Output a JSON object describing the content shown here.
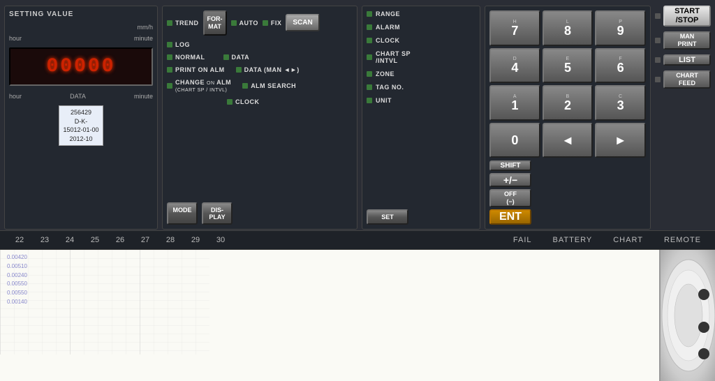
{
  "panel": {
    "setting_value": {
      "title": "SETTING VALUE",
      "unit_label": "mm/h",
      "hour_label": "hour",
      "minute_label": "minute",
      "display_value": "00000",
      "data_label": "DATA",
      "bottom_hour": "hour",
      "bottom_minute": "minute"
    },
    "sticker": {
      "line1": "256429",
      "line2": "D-K-",
      "line3": "15012-01-00",
      "line4": "2012-10"
    },
    "buttons": {
      "trend": "TREND",
      "log": "LOG",
      "format": "FOR-\nMAT",
      "auto": "AUTO",
      "fix": "FIX",
      "scan": "SCAN",
      "normal": "NORMAL",
      "data": "DATA",
      "print_on_alm": "PRINT ON ALM",
      "data_man": "DATA (MAN ◄►)",
      "change_on_alm": "CHANGE ON ALM",
      "change_sub": "(CHART SP / INTVL)",
      "alm_search": "ALM SEARCH",
      "clock": "CLOCK",
      "mode": "MODE",
      "display": "DIS-\nPLAY",
      "set": "SET"
    },
    "indicators": {
      "range": "RANGE",
      "alarm": "ALARM",
      "clock": "CLOCK",
      "chart_sp": "CHART SP\n/INTVL",
      "zone": "ZONE",
      "tag_no": "TAG NO.",
      "unit": "UNIT"
    },
    "numpad": {
      "rows": [
        [
          {
            "main": "7",
            "sub": "H"
          },
          {
            "main": "8",
            "sub": "L"
          },
          {
            "main": "9",
            "sub": "P"
          }
        ],
        [
          {
            "main": "4",
            "sub": "D"
          },
          {
            "main": "5",
            "sub": "E"
          },
          {
            "main": "6",
            "sub": "F"
          }
        ],
        [
          {
            "main": "1",
            "sub": "A"
          },
          {
            "main": "2",
            "sub": "B"
          },
          {
            "main": "3",
            "sub": "C"
          }
        ],
        [
          {
            "main": "0",
            "sub": ""
          },
          {
            "main": "◄",
            "sub": ""
          },
          {
            "main": "►",
            "sub": ""
          }
        ]
      ],
      "shift": "SHIFT",
      "plus_minus": "+/−",
      "off": "OFF\n(−)",
      "ent": "ENT"
    },
    "action_buttons": {
      "start_stop": "START\n/STOP",
      "man_print": "MAN\nPRINT",
      "list": "LIST",
      "chart_feed": "CHART\nFEED"
    }
  },
  "status_bar": {
    "scale_numbers": [
      "22",
      "23",
      "24",
      "25",
      "26",
      "27",
      "28",
      "29",
      "30"
    ],
    "indicators": [
      "FAIL",
      "BATTERY",
      "CHART",
      "REMOTE"
    ]
  },
  "chart": {
    "text_lines": [
      "0.00420",
      "0.00510",
      "0.00240",
      "0.00550",
      "0.00550",
      "0.00140"
    ]
  },
  "colors": {
    "panel_bg": "#2a2d35",
    "led_green": "#3a7a3a",
    "display_red": "#cc2200",
    "ent_orange": "#cc8800",
    "start_stop_white": "#e8e8e8"
  }
}
